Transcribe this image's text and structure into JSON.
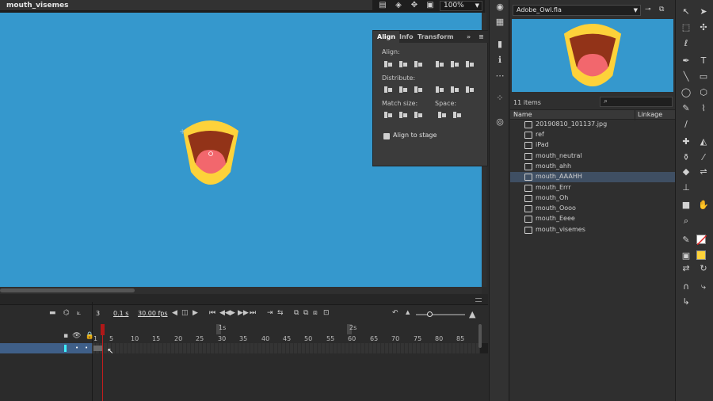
{
  "document": {
    "tab_title": "mouth_visemes",
    "zoom": "100%"
  },
  "align_panel": {
    "tabs": [
      "Align",
      "Info",
      "Transform"
    ],
    "align_label": "Align:",
    "distribute_label": "Distribute:",
    "match_size_label": "Match size:",
    "space_label": "Space:",
    "align_to_stage_label": "Align to stage",
    "align_to_stage_checked": true
  },
  "library": {
    "selected_file": "Adobe_Owl.fla",
    "item_count": "11 items",
    "col_name": "Name",
    "col_linkage": "Linkage",
    "items": [
      {
        "label": "20190810_101137.jpg",
        "icon": "bitmap-icon"
      },
      {
        "label": "ref",
        "icon": "symbol-icon"
      },
      {
        "label": "iPad",
        "icon": "symbol-icon"
      },
      {
        "label": "mouth_neutral",
        "icon": "symbol-icon"
      },
      {
        "label": "mouth_ahh",
        "icon": "symbol-icon"
      },
      {
        "label": "mouth_AAAHH",
        "icon": "symbol-icon",
        "selected": true
      },
      {
        "label": "mouth_Errr",
        "icon": "symbol-icon"
      },
      {
        "label": "mouth_Oh",
        "icon": "symbol-icon"
      },
      {
        "label": "mouth_Oooo",
        "icon": "symbol-icon"
      },
      {
        "label": "mouth_Eeee",
        "icon": "symbol-icon"
      },
      {
        "label": "mouth_visemes",
        "icon": "symbol-icon"
      }
    ]
  },
  "timeline": {
    "current_frame": "3",
    "elapsed": "0.1 s",
    "fps": "30.00 fps",
    "ruler_seconds": [
      "1s",
      "2s"
    ],
    "ruler_frames": [
      "1",
      "5",
      "10",
      "15",
      "20",
      "25",
      "30",
      "35",
      "40",
      "45",
      "50",
      "55",
      "60",
      "65",
      "70",
      "75",
      "80",
      "85"
    ]
  },
  "colors": {
    "stage": "#3598cd",
    "mouth_outer": "#fdd23a",
    "mouth_inner": "#923318",
    "tongue": "#f2676d",
    "playhead": "#c41e1e",
    "selection": "#3f4f63"
  }
}
